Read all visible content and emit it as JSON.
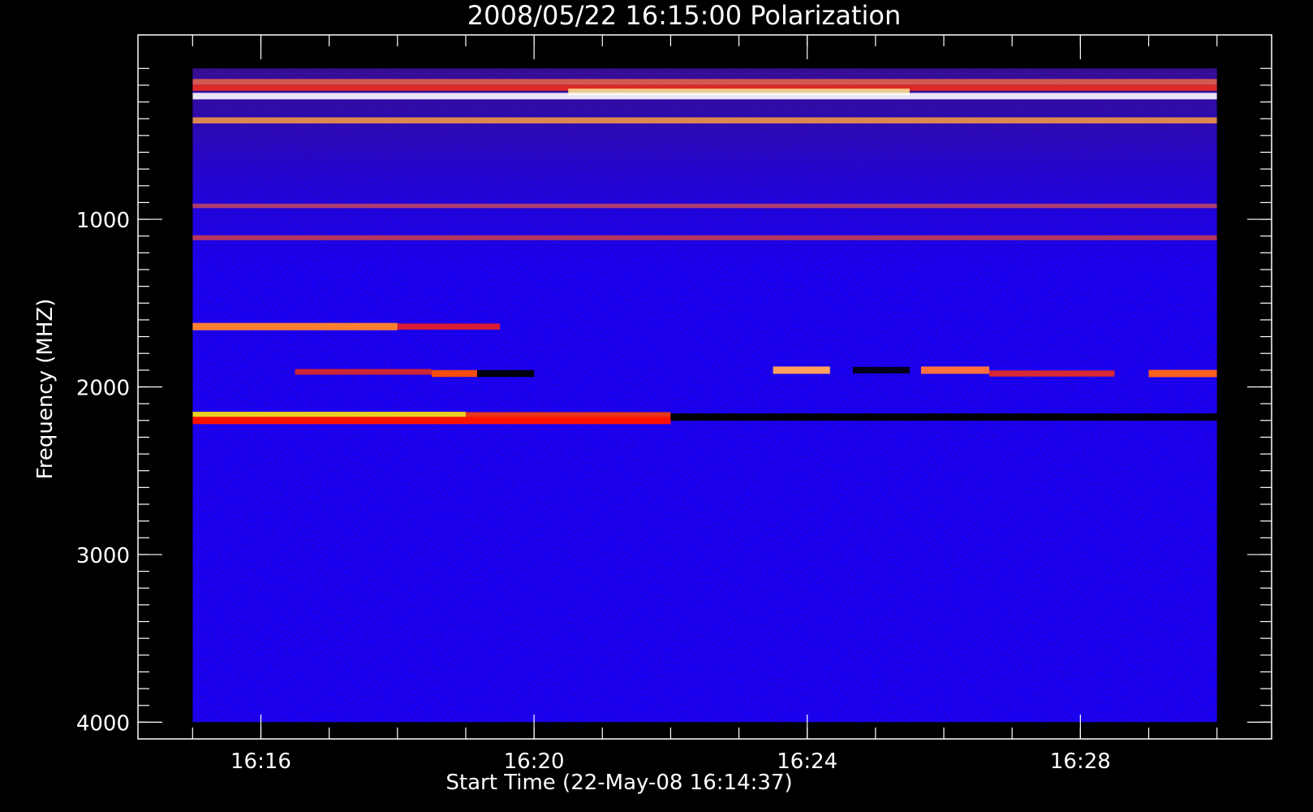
{
  "chart_data": {
    "type": "heatmap",
    "title": "2008/05/22 16:15:00 Polarization",
    "xlabel": "Start Time (22-May-08 16:14:37)",
    "ylabel": "Frequency (MHZ)",
    "x_range": [
      "16:15:00",
      "16:30:00"
    ],
    "xlim": [
      "16:14:12",
      "16:30:48"
    ],
    "y_range": [
      100,
      4000
    ],
    "ylim": [
      4100,
      -100
    ],
    "x_ticks": [
      "16:16",
      "16:20",
      "16:24",
      "16:28"
    ],
    "y_ticks": [
      1000,
      2000,
      3000,
      4000
    ],
    "x_minor_step_min": 1,
    "y_minor_step": 100,
    "background_color": "#1400ff",
    "colors": {
      "axes": "#ffffff",
      "background": "#000000"
    },
    "bands": [
      {
        "freq": 180,
        "start": "16:15:00",
        "end": "16:30:00",
        "color": "#ff7040",
        "intensity": 0.6
      },
      {
        "freq": 215,
        "start": "16:15:00",
        "end": "16:30:00",
        "color": "#ff3010",
        "intensity": 0.7
      },
      {
        "freq": 240,
        "start": "16:20:30",
        "end": "16:25:30",
        "color": "#ffe090",
        "intensity": 0.8
      },
      {
        "freq": 265,
        "start": "16:15:00",
        "end": "16:30:00",
        "color": "#ffffff",
        "intensity": 0.8
      },
      {
        "freq": 410,
        "start": "16:15:00",
        "end": "16:30:00",
        "color": "#ffa040",
        "intensity": 0.7
      },
      {
        "freq": 920,
        "start": "16:15:00",
        "end": "16:30:00",
        "color": "#ff6030",
        "intensity": 0.3
      },
      {
        "freq": 1110,
        "start": "16:15:00",
        "end": "16:30:00",
        "color": "#ff5020",
        "intensity": 0.4
      },
      {
        "freq": 1640,
        "start": "16:15:00",
        "end": "16:18:00",
        "color": "#ff8030",
        "intensity": 1.0
      },
      {
        "freq": 1640,
        "start": "16:18:00",
        "end": "16:19:30",
        "color": "#ff2010",
        "intensity": 0.7
      },
      {
        "freq": 1910,
        "start": "16:16:30",
        "end": "16:18:30",
        "color": "#ff3000",
        "intensity": 0.6
      },
      {
        "freq": 1920,
        "start": "16:18:30",
        "end": "16:19:10",
        "color": "#ff5000",
        "intensity": 0.9
      },
      {
        "freq": 1920,
        "start": "16:19:10",
        "end": "16:20:00",
        "color": "#000000",
        "intensity": 0.9
      },
      {
        "freq": 1900,
        "start": "16:23:30",
        "end": "16:24:20",
        "color": "#ffa060",
        "intensity": 1.0
      },
      {
        "freq": 1900,
        "start": "16:24:40",
        "end": "16:25:30",
        "color": "#000000",
        "intensity": 0.8
      },
      {
        "freq": 1900,
        "start": "16:25:40",
        "end": "16:26:40",
        "color": "#ff7040",
        "intensity": 1.0
      },
      {
        "freq": 1920,
        "start": "16:26:40",
        "end": "16:28:30",
        "color": "#ff3010",
        "intensity": 0.7
      },
      {
        "freq": 1920,
        "start": "16:29:00",
        "end": "16:30:00",
        "color": "#ff6020",
        "intensity": 1.0
      },
      {
        "freq": 2170,
        "start": "16:15:00",
        "end": "16:19:00",
        "color": "#e8d020",
        "intensity": 1.0
      },
      {
        "freq": 2170,
        "start": "16:19:00",
        "end": "16:22:00",
        "color": "#ff4000",
        "intensity": 0.8
      },
      {
        "freq": 2200,
        "start": "16:15:00",
        "end": "16:22:00",
        "color": "#ff1000",
        "intensity": 1.0
      },
      {
        "freq": 2180,
        "start": "16:22:00",
        "end": "16:30:00",
        "color": "#000000",
        "intensity": 1.0
      }
    ]
  }
}
